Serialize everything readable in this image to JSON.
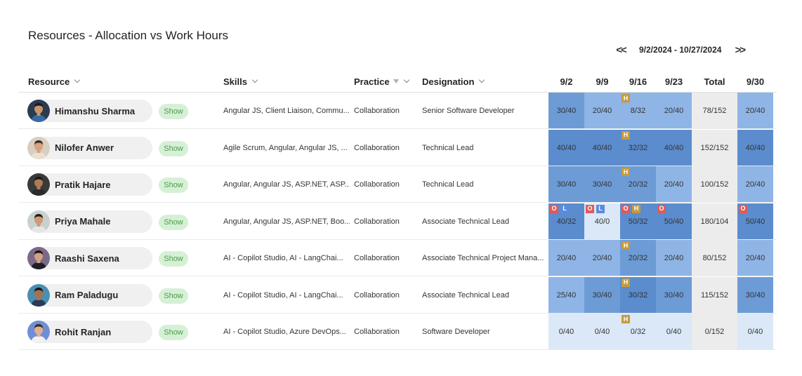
{
  "title": "Resources - Allocation vs Work Hours",
  "date_nav": {
    "prev": "<<",
    "range": "9/2/2024 - 10/27/2024",
    "next": ">>"
  },
  "columns": {
    "resource": "Resource",
    "skills": "Skills",
    "practice": "Practice",
    "designation": "Designation",
    "weeks": [
      "9/2",
      "9/9",
      "9/16",
      "9/23"
    ],
    "total": "Total",
    "next_week": "9/30"
  },
  "colors": {
    "dark": "#5b8ccd",
    "mid": "#6d9bd6",
    "light": "#8fb5e6",
    "pale": "#dbe8f7",
    "total_bg": "#ececec",
    "show_bg": "#d6f0d6"
  },
  "rows": [
    {
      "name": "Himanshu Sharma",
      "show": "Show",
      "skills": "Angular JS, Client Liaison, Commu...",
      "practice": "Collaboration",
      "designation": "Senior Software Developer",
      "avatar": {
        "bg": "#2a3b52",
        "skin": "#c9956d",
        "hair": "#1a1a1a",
        "shirt": "#3a6aa3"
      },
      "cells": [
        {
          "value": "30/40",
          "shade": "mid",
          "badges": []
        },
        {
          "value": "20/40",
          "shade": "light",
          "badges": []
        },
        {
          "value": "8/32",
          "shade": "light",
          "badges": [
            "H"
          ]
        },
        {
          "value": "20/40",
          "shade": "light",
          "badges": []
        }
      ],
      "total": "78/152",
      "next": {
        "value": "20/40",
        "shade": "light",
        "badges": []
      }
    },
    {
      "name": "Nilofer Anwer",
      "show": "Show",
      "skills": "Agile Scrum, Angular, Angular JS, ...",
      "practice": "Collaboration",
      "designation": "Technical Lead",
      "avatar": {
        "bg": "#d9cfc0",
        "skin": "#d7a27f",
        "hair": "#3a2a1e",
        "shirt": "#e8e0d0"
      },
      "cells": [
        {
          "value": "40/40",
          "shade": "dark",
          "badges": []
        },
        {
          "value": "40/40",
          "shade": "dark",
          "badges": []
        },
        {
          "value": "32/32",
          "shade": "dark",
          "badges": [
            "H"
          ]
        },
        {
          "value": "40/40",
          "shade": "dark",
          "badges": []
        }
      ],
      "total": "152/152",
      "next": {
        "value": "40/40",
        "shade": "dark",
        "badges": []
      }
    },
    {
      "name": "Pratik Hajare",
      "show": "Show",
      "skills": "Angular, Angular JS, ASP.NET, ASP....",
      "practice": "Collaboration",
      "designation": "Technical Lead",
      "avatar": {
        "bg": "#3a3a3a",
        "skin": "#b07a55",
        "hair": "#151515",
        "shirt": "#2b2b2b"
      },
      "cells": [
        {
          "value": "30/40",
          "shade": "mid",
          "badges": []
        },
        {
          "value": "30/40",
          "shade": "mid",
          "badges": []
        },
        {
          "value": "20/32",
          "shade": "mid",
          "badges": [
            "H"
          ]
        },
        {
          "value": "20/40",
          "shade": "light",
          "badges": []
        }
      ],
      "total": "100/152",
      "next": {
        "value": "20/40",
        "shade": "light",
        "badges": []
      }
    },
    {
      "name": "Priya Mahale",
      "show": "Show",
      "skills": "Angular, Angular JS, ASP.NET, Boo...",
      "practice": "Collaboration",
      "designation": "Associate Technical Lead",
      "avatar": {
        "bg": "#c8d2cc",
        "skin": "#d09a78",
        "hair": "#2a1a14",
        "shirt": "#e6e6ea"
      },
      "cells": [
        {
          "value": "40/32",
          "shade": "dark",
          "badges": [
            "O",
            "L"
          ]
        },
        {
          "value": "40/0",
          "shade": "pale",
          "badges": [
            "O",
            "L"
          ]
        },
        {
          "value": "50/32",
          "shade": "dark",
          "badges": [
            "O",
            "H"
          ]
        },
        {
          "value": "50/40",
          "shade": "dark",
          "badges": [
            "O"
          ]
        }
      ],
      "total": "180/104",
      "next": {
        "value": "50/40",
        "shade": "dark",
        "badges": [
          "O"
        ]
      }
    },
    {
      "name": "Raashi Saxena",
      "show": "Show",
      "skills": "AI - Copilot Studio, AI - LangChai...",
      "practice": "Collaboration",
      "designation": "Associate Technical Project Mana...",
      "avatar": {
        "bg": "#7b6a86",
        "skin": "#d3a184",
        "hair": "#1c1410",
        "shirt": "#1e1e2a"
      },
      "cells": [
        {
          "value": "20/40",
          "shade": "light",
          "badges": []
        },
        {
          "value": "20/40",
          "shade": "light",
          "badges": []
        },
        {
          "value": "20/32",
          "shade": "mid",
          "badges": [
            "H"
          ]
        },
        {
          "value": "20/40",
          "shade": "light",
          "badges": []
        }
      ],
      "total": "80/152",
      "next": {
        "value": "20/40",
        "shade": "light",
        "badges": []
      }
    },
    {
      "name": "Ram Paladugu",
      "show": "Show",
      "skills": "AI - Copilot Studio, AI - LangChai...",
      "practice": "Collaboration",
      "designation": "Associate Technical Lead",
      "avatar": {
        "bg": "#4a8fb0",
        "skin": "#a8724e",
        "hair": "#151515",
        "shirt": "#2b3a55"
      },
      "cells": [
        {
          "value": "25/40",
          "shade": "light",
          "badges": []
        },
        {
          "value": "30/40",
          "shade": "mid",
          "badges": []
        },
        {
          "value": "30/32",
          "shade": "dark",
          "badges": [
            "H"
          ]
        },
        {
          "value": "30/40",
          "shade": "mid",
          "badges": []
        }
      ],
      "total": "115/152",
      "next": {
        "value": "30/40",
        "shade": "mid",
        "badges": []
      }
    },
    {
      "name": "Rohit Ranjan",
      "show": "Show",
      "skills": "AI - Copilot Studio, Azure DevOps...",
      "practice": "Collaboration",
      "designation": "Software Developer",
      "avatar": {
        "bg": "#6e8fd6",
        "skin": "#e0b08e",
        "hair": "#3a2a20",
        "shirt": "#f2f2f2"
      },
      "cells": [
        {
          "value": "0/40",
          "shade": "pale",
          "badges": []
        },
        {
          "value": "0/40",
          "shade": "pale",
          "badges": []
        },
        {
          "value": "0/32",
          "shade": "pale",
          "badges": [
            "H"
          ]
        },
        {
          "value": "0/40",
          "shade": "pale",
          "badges": []
        }
      ],
      "total": "0/152",
      "next": {
        "value": "0/40",
        "shade": "pale",
        "badges": []
      }
    }
  ]
}
